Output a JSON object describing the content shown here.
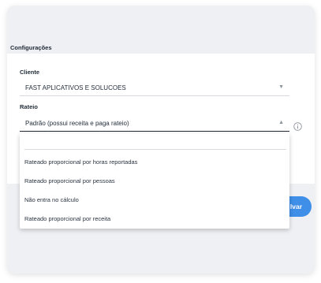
{
  "section": {
    "title": "Configurações"
  },
  "cliente": {
    "label": "Cliente",
    "value": "FAST APLICATIVOS E SOLUCOES"
  },
  "rateio": {
    "label": "Rateio",
    "value": "Padrão (possui receita e paga rateio)",
    "options": [
      "Rateado proporcional por horas reportadas",
      "Rateado proporcional por pessoas",
      "Não entra no cálculo",
      "Rateado proporcional por receita"
    ]
  },
  "buttons": {
    "save_label": "lvar"
  },
  "icons": {
    "dropdown_closed": "caret-down-icon",
    "dropdown_open": "caret-up-icon",
    "info": "info-icon"
  },
  "colors": {
    "accent": "#3f8ee8",
    "card_background": "#eef0f4",
    "text": "#1f2a37"
  }
}
